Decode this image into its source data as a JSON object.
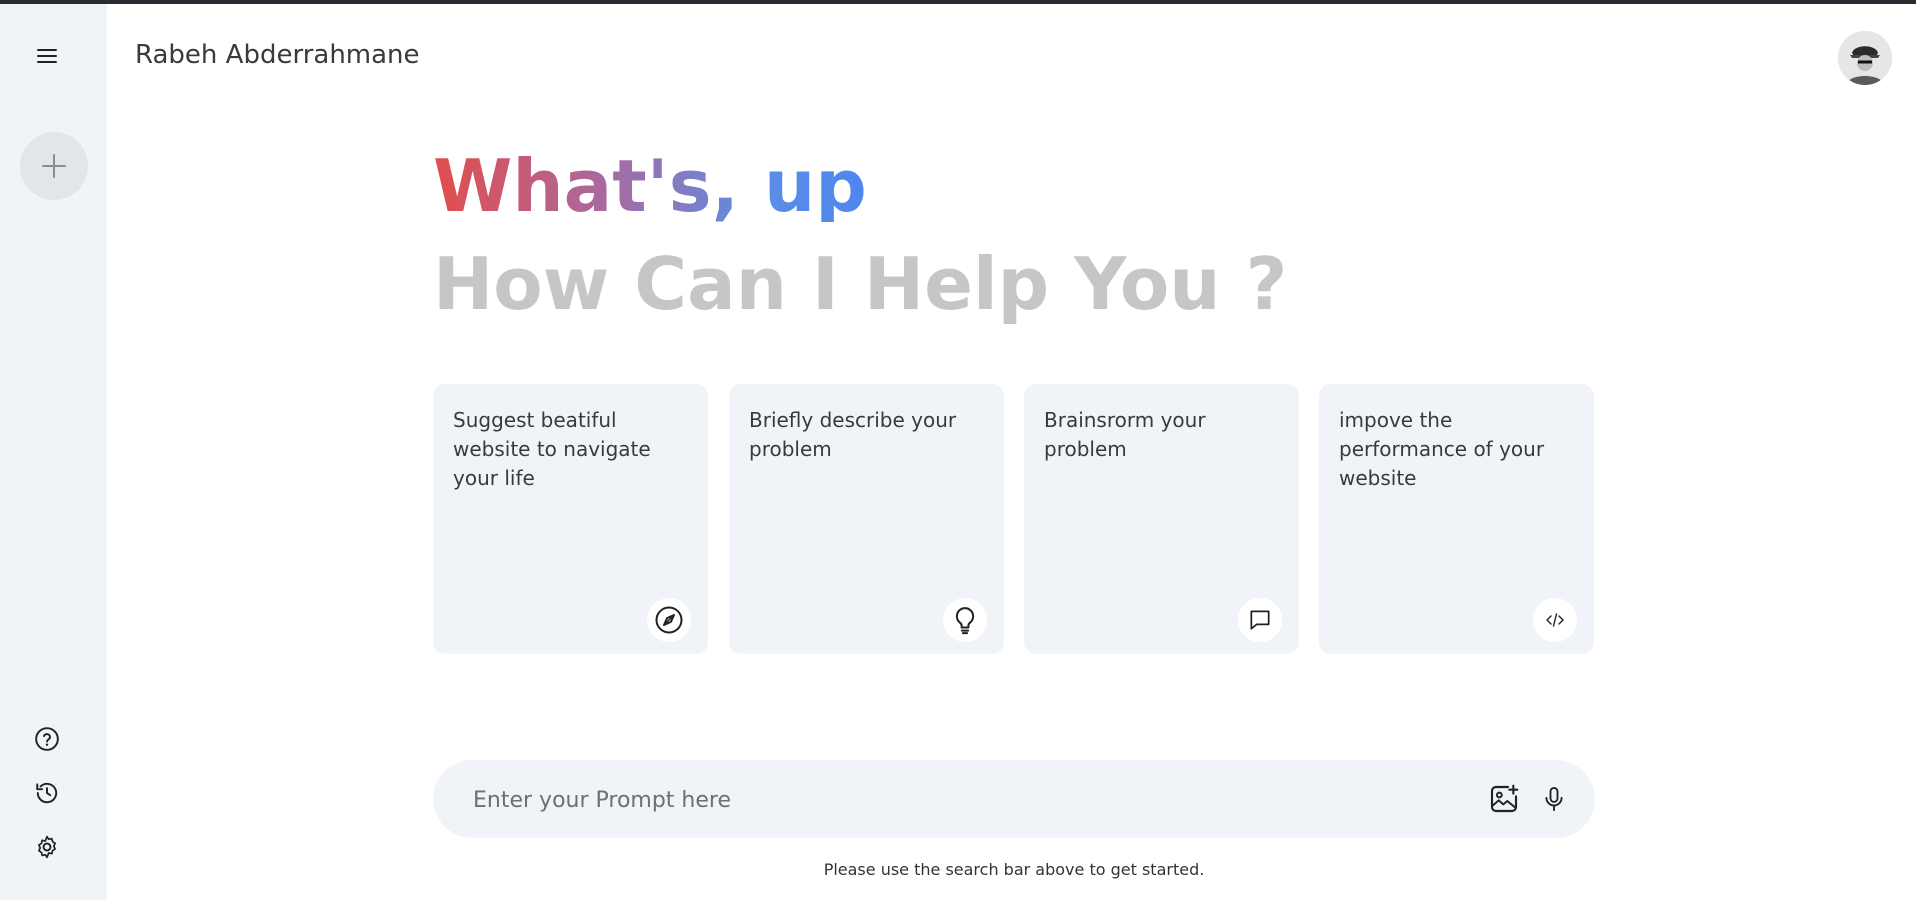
{
  "header": {
    "title": "Rabeh Abderrahmane"
  },
  "sidebar": {
    "items": [
      {
        "icon": "menu-icon"
      },
      {
        "icon": "plus-icon"
      },
      {
        "icon": "question-icon"
      },
      {
        "icon": "history-icon"
      },
      {
        "icon": "gear-icon"
      }
    ]
  },
  "greeting": {
    "line1": "What's, up",
    "line2": "How Can I Help You ?"
  },
  "cards": [
    {
      "text": "Suggest beatiful website to navigate your life",
      "icon": "compass-icon"
    },
    {
      "text": "Briefly describe your problem",
      "icon": "bulb-icon"
    },
    {
      "text": "Brainsrorm your problem",
      "icon": "message-icon"
    },
    {
      "text": "impove the performance of your website",
      "icon": "code-icon"
    }
  ],
  "prompt": {
    "placeholder": "Enter your Prompt here",
    "value": ""
  },
  "footer": {
    "note": "Please use the search bar above to get started."
  },
  "colors": {
    "sidebar_bg": "#f0f4f9",
    "card_bg": "#f0f4f9",
    "greeting_gradient_start": "#e24d4d",
    "greeting_gradient_end": "#4f86f0",
    "subtitle": "#c4c7c5"
  }
}
